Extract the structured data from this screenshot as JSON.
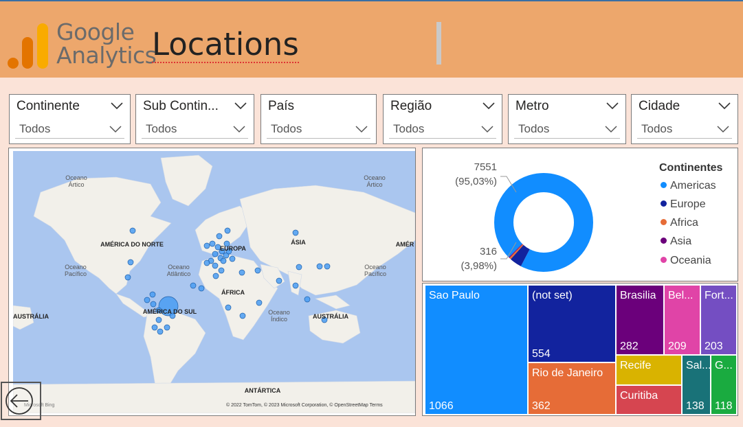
{
  "header": {
    "logo_line1": "Google",
    "logo_line2": "Analytics",
    "title": "Locations"
  },
  "slicers": [
    {
      "label": "Continente",
      "value": "Todos"
    },
    {
      "label": "Sub Contin...",
      "value": "Todos"
    },
    {
      "label": "País",
      "value": "Todos"
    },
    {
      "label": "Região",
      "value": "Todos"
    },
    {
      "label": "Metro",
      "value": "Todos"
    },
    {
      "label": "Cidade",
      "value": "Todos"
    }
  ],
  "map": {
    "labels": {
      "arctic_left": "Oceano Ártico",
      "arctic_right": "Oceano Ártico",
      "north_america": "AMÉRICA DO NORTE",
      "europe": "EUROPA",
      "asia": "ÁSIA",
      "america_right": "AMÉR",
      "pacific_left": "Oceano Pacífico",
      "atlantic": "Oceano Atlântico",
      "pacific_right": "Oceano Pacífico",
      "africa": "ÁFRICA",
      "australia_left": "AUSTRÁLIA",
      "south_america": "AMÉRICA DO SUL",
      "indian": "Oceano Índico",
      "australia_right": "AUSTRÁLIA",
      "antarctica": "ANTÁRTICA"
    },
    "attribution": "© 2022 TomTom, © 2023 Microsoft Corporation, © OpenStreetMap  Terms",
    "bing": "Microsoft Bing"
  },
  "donut": {
    "legend_title": "Continentes",
    "legend": [
      {
        "name": "Americas",
        "color": "#118dff"
      },
      {
        "name": "Europe",
        "color": "#12239e"
      },
      {
        "name": "Africa",
        "color": "#e66c37"
      },
      {
        "name": "Asia",
        "color": "#6b007b"
      },
      {
        "name": "Oceania",
        "color": "#e044a7"
      }
    ],
    "top_value": "7551",
    "top_pct": "(95,03%)",
    "bottom_value": "316",
    "bottom_pct": "(3,98%)",
    "shares": [
      0.9503,
      0.0398,
      0.006,
      0.003,
      0.001
    ]
  },
  "treemap": [
    {
      "name": "Sao Paulo",
      "value": "1066",
      "color": "#118dff"
    },
    {
      "name": "(not set)",
      "value": "554",
      "color": "#12239e"
    },
    {
      "name": "Rio de Janeiro",
      "value": "362",
      "color": "#e66c37"
    },
    {
      "name": "Brasilia",
      "value": "282",
      "color": "#6b007b"
    },
    {
      "name": "Bel...",
      "value": "209",
      "color": "#e044a7"
    },
    {
      "name": "Fort...",
      "value": "203",
      "color": "#744ec2"
    },
    {
      "name": "Recife",
      "value": "",
      "color": "#d9b300"
    },
    {
      "name": "Curitiba",
      "value": "",
      "color": "#d64550"
    },
    {
      "name": "Sal...",
      "value": "138",
      "color": "#197278"
    },
    {
      "name": "G...",
      "value": "118",
      "color": "#1aab40"
    }
  ]
}
